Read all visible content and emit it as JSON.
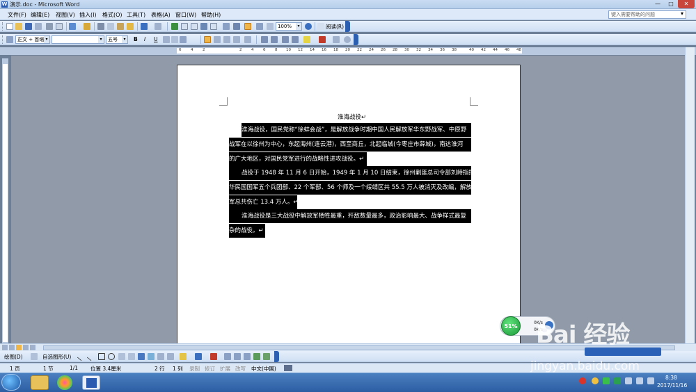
{
  "window": {
    "title": "演示.doc - Microsoft Word",
    "min": "—",
    "max": "□",
    "close": "✕"
  },
  "menu": [
    "文件(F)",
    "编辑(E)",
    "视图(V)",
    "插入(I)",
    "格式(O)",
    "工具(T)",
    "表格(A)",
    "窗口(W)",
    "帮助(H)"
  ],
  "help_placeholder": "键入需要帮助的问题",
  "toolbar1": {
    "zoom": "100%",
    "read_label": "阅读(R)"
  },
  "toolbar2": {
    "style": "正文 + 首缩",
    "size": "五号",
    "bold": "B",
    "italic": "I",
    "underline": "U"
  },
  "ruler_numbers": [
    "6",
    "4",
    "2",
    "2",
    "4",
    "6",
    "8",
    "10",
    "12",
    "14",
    "16",
    "18",
    "20",
    "22",
    "24",
    "26",
    "28",
    "30",
    "32",
    "34",
    "36",
    "38",
    "40",
    "42",
    "44",
    "46",
    "48"
  ],
  "document": {
    "title": "淮海战役↵",
    "lines": [
      "淮海战役，国民党称“徐蚌会战”，是解放战争时期中国人民解放军华东野战军、中原野",
      "战军在以徐州为中心，东起海州(连云港)，西至商丘，北起临城(今枣庄市薛城)，南达淮河",
      "的广大地区，对国民党军进行的战略性进攻战役。↵",
      "战役于 1948 年 11 月 6 日开始，1949 年 1 月 10 日结束，徐州剿匪总司令部刘峙指挥中",
      "华民国国军五个兵团部、22 个军部、56 个师及一个绥靖区共 55.5 万人被消灭及改编，解放",
      "军总共伤亡 13.4 万人。↵",
      "淮海战役是三大战役中解放军牺牲最重，歼敌数量最多，政治影响最大、战争样式最复",
      "杂的战役。↵"
    ]
  },
  "drawbar": {
    "draw": "绘图(D)",
    "autoshape": "自选图形(U)"
  },
  "status": {
    "page": "1 页",
    "section": "1 节",
    "pages": "1/1",
    "position": "位置 3.4厘米",
    "line": "2 行",
    "col": "1 列",
    "rec": "录制",
    "trk": "修订",
    "ext": "扩展",
    "ovr": "改写",
    "lang": "中文(中国)"
  },
  "net_widget": {
    "percent": "51%",
    "up": "0K/s",
    "down": "0K/s"
  },
  "watermark": {
    "logo": "Bai  经验",
    "url": "jingyan.baidu.com"
  },
  "tray": {
    "time": "8:38",
    "date": "2017/11/16"
  },
  "colors": {
    "taskbar": "#2c5ea3",
    "doc_bg": "#909aa8",
    "selection": "#000000"
  }
}
